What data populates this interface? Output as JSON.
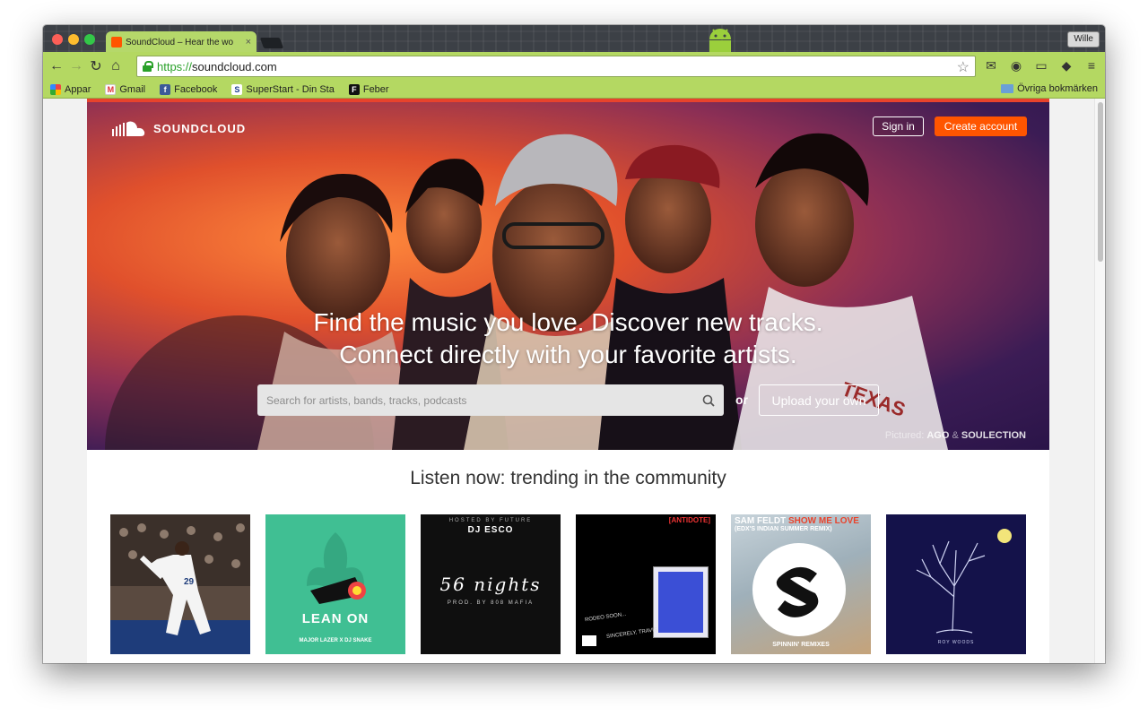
{
  "browser": {
    "tab_title": "SoundCloud – Hear the wo",
    "tab_close": "×",
    "user_button": "Wille",
    "url_protocol": "https://",
    "url_host": "soundcloud.com",
    "bookmarks": [
      "Appar",
      "Gmail",
      "Facebook",
      "SuperStart - Din Sta",
      "Feber"
    ],
    "other_bookmarks": "Övriga bokmärken"
  },
  "header": {
    "logo_text": "SOUNDCLOUD",
    "sign_in": "Sign in",
    "create_account": "Create account"
  },
  "hero": {
    "headline_line1": "Find the music you love. Discover new tracks.",
    "headline_line2": "Connect directly with your favorite artists.",
    "search_placeholder": "Search for artists, bands, tracks, podcasts",
    "or": "or",
    "upload": "Upload your own",
    "pictured_label": "Pictured:",
    "pictured_artist1": "AGO",
    "pictured_amp": "&",
    "pictured_artist2": "SOULECTION"
  },
  "trending": {
    "title": "Listen now: trending in the community",
    "tiles": [
      {
        "name": "baseball-artwork"
      },
      {
        "name": "lean-on-artwork",
        "text": "LEAN ON",
        "sub": "MAJOR LAZER X DJ SNAKE"
      },
      {
        "name": "56-nights-artwork",
        "top": "HOSTED BY FUTURE",
        "title": "DJ ESCO",
        "script": "56 nights",
        "sub": "PROD. BY 808 MAFIA"
      },
      {
        "name": "antidote-artwork",
        "tag": "[ANTIDOTE]",
        "note1": "RODEO SOON...",
        "note2": "SINCERELY, TRAVIS"
      },
      {
        "name": "show-me-love-artwork",
        "line1": "SAM FELDT",
        "line1b": "SHOW ME LOVE",
        "line2": "(EDX'S INDIAN SUMMER REMIX)",
        "footer": "SPINNIN' REMIXES"
      },
      {
        "name": "tree-artwork",
        "sub": "ROY WOODS"
      }
    ]
  },
  "colors": {
    "accent": "#ff5500",
    "toolbar": "#b4d862"
  }
}
